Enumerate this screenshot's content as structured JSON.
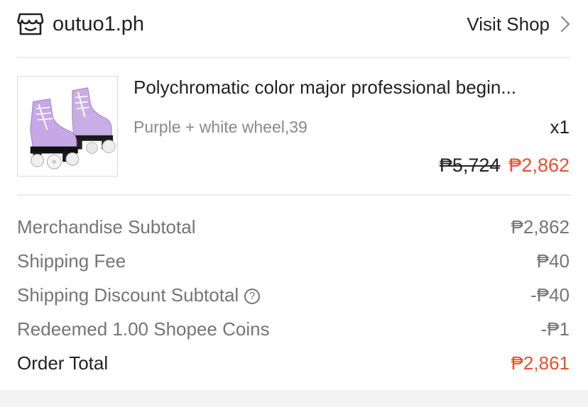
{
  "shop": {
    "name": "outuo1.ph",
    "visit_label": "Visit Shop"
  },
  "product": {
    "title": "Polychromatic color major professional  begin...",
    "variant": "Purple + white wheel,39",
    "quantity": "x1",
    "original_price": "₱5,724",
    "sale_price": "₱2,862",
    "image_icon": "roller-skates-image"
  },
  "summary": {
    "merch_label": "Merchandise Subtotal",
    "merch_value": "₱2,862",
    "shipping_label": "Shipping Fee",
    "shipping_value": "₱40",
    "ship_discount_label": "Shipping Discount Subtotal",
    "ship_discount_help": "?",
    "ship_discount_value": "-₱40",
    "coins_label": "Redeemed 1.00 Shopee Coins",
    "coins_value": "-₱1",
    "total_label": "Order Total",
    "total_value": "₱2,861"
  },
  "colors": {
    "accent": "#ee4d2d",
    "text": "#222222",
    "muted": "#757575"
  }
}
